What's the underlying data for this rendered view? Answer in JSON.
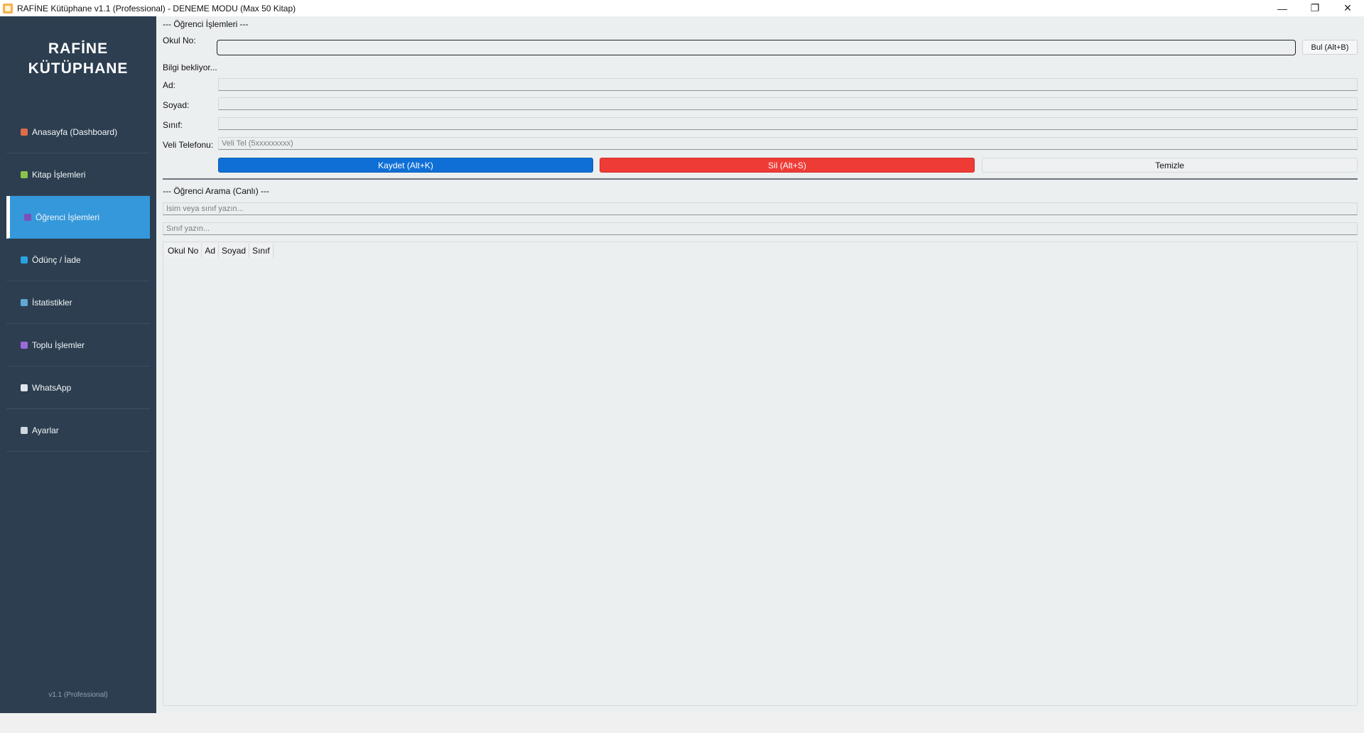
{
  "window": {
    "title": "RAFİNE Kütüphane v1.1 (Professional) - DENEME MODU (Max 50 Kitap)",
    "minimize": "—",
    "restore": "❐",
    "close": "✕"
  },
  "sidebar": {
    "brand_line1": "RAFİNE",
    "brand_line2": "KÜTÜPHANE",
    "items": [
      {
        "label": "Anasayfa (Dashboard)",
        "icon": "house-icon",
        "color": "#e06c4a"
      },
      {
        "label": "Kitap İşlemleri",
        "icon": "books-icon",
        "color": "#8bc34a"
      },
      {
        "label": "Öğrenci İşlemleri",
        "icon": "students-icon",
        "color": "#7e4fb8"
      },
      {
        "label": "Ödünç / İade",
        "icon": "exchange-icon",
        "color": "#29a3e0"
      },
      {
        "label": "İstatistikler",
        "icon": "chart-icon",
        "color": "#5fa8d3"
      },
      {
        "label": "Toplu İşlemler",
        "icon": "bulk-icon",
        "color": "#9c6ad8"
      },
      {
        "label": "WhatsApp",
        "icon": "chat-icon",
        "color": "#dfe6ec"
      },
      {
        "label": "Ayarlar",
        "icon": "gear-icon",
        "color": "#cfd8df"
      }
    ],
    "active_index": 2,
    "version": "v1.1 (Professional)"
  },
  "student_form": {
    "section_title": "--- Öğrenci İşlemleri ---",
    "school_no_label": "Okul No:",
    "school_no_value": "",
    "find_button": "Bul (Alt+B)",
    "status_text": "Bilgi bekliyor...",
    "name_label": "Ad:",
    "surname_label": "Soyad:",
    "class_label": "Sınıf:",
    "parent_phone_label": "Veli Telefonu:",
    "parent_phone_placeholder": "Veli Tel (5xxxxxxxxx)",
    "save_button": "Kaydet (Alt+K)",
    "delete_button": "Sil (Alt+S)",
    "clear_button": "Temizle"
  },
  "search": {
    "section_title": "--- Öğrenci Arama (Canlı) ---",
    "name_placeholder": "İsim veya sınıf yazın...",
    "class_placeholder": "Sınıf yazın...",
    "columns": [
      "Okul No",
      "Ad",
      "Soyad",
      "Sınıf"
    ]
  },
  "colors": {
    "sidebar_bg": "#2c3e50",
    "active_item": "#3498db",
    "save": "#0f6fd6",
    "delete": "#ef3b36"
  }
}
